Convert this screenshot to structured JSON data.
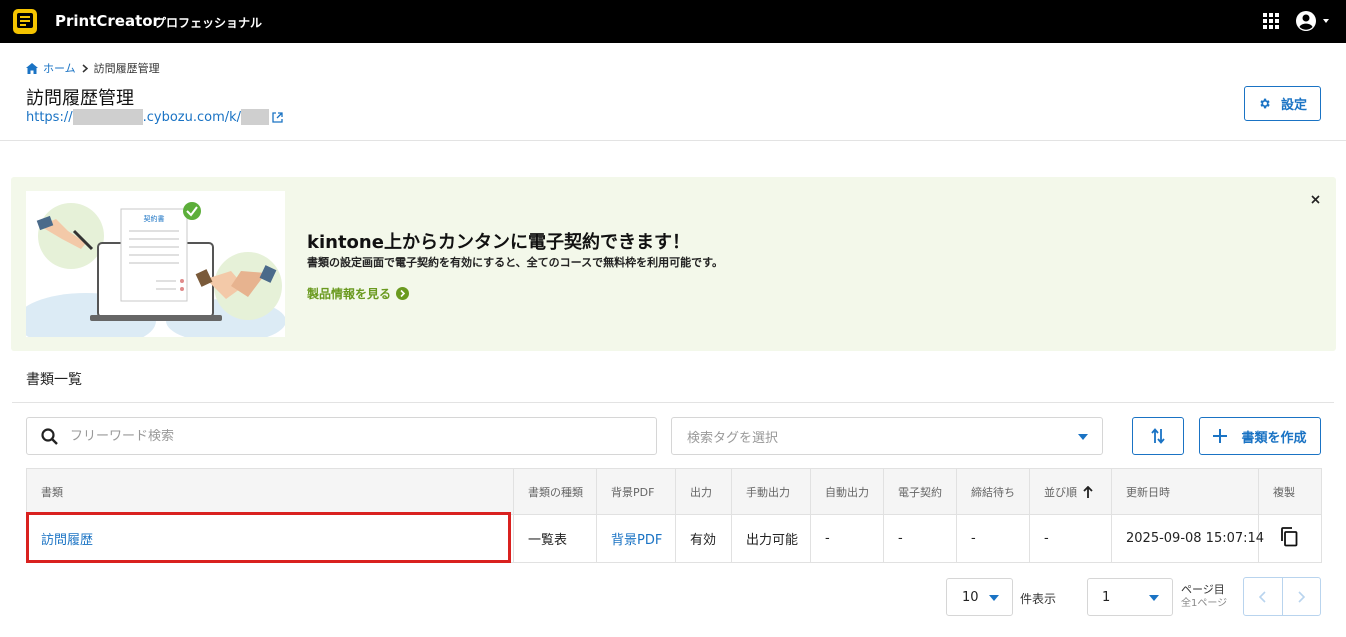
{
  "topbar": {
    "brand": "PrintCreator",
    "edition": "プロフェッショナル",
    "icons": {
      "logo": "printcreator-logo",
      "apps": "grid-apps-icon",
      "user": "account-circle-icon"
    }
  },
  "breadcrumb": {
    "home": "ホーム",
    "current": "訪問履歴管理"
  },
  "page": {
    "title": "訪問履歴管理",
    "url_prefix": "https://",
    "url_domain": ".cybozu.com/k/",
    "settings_label": "設定"
  },
  "banner": {
    "doc_label": "契約書",
    "title": "kintone上からカンタンに電子契約できます！",
    "subtitle": "書類の設定画面で電子契約を有効にすると、全てのコースで無料枠を利用可能です。",
    "link": "製品情報を見る",
    "accent_color": "#6a9a1f"
  },
  "section": {
    "title": "書類一覧"
  },
  "toolbar": {
    "search_placeholder": "フリーワード検索",
    "tag_placeholder": "検索タグを選択",
    "create_label": "書類を作成"
  },
  "table": {
    "headers": [
      "書類",
      "書類の種類",
      "背景PDF",
      "出力",
      "手動出力",
      "自動出力",
      "電子契約",
      "締結待ち",
      "並び順",
      "更新日時",
      "複製"
    ],
    "rows": [
      [
        "訪問履歴",
        "一覧表",
        "背景PDF",
        "有効",
        "出力可能",
        "-",
        "-",
        "-",
        "-",
        "2025-09-08 15:07:14"
      ]
    ]
  },
  "pagination": {
    "per_page": "10",
    "per_page_label": "件表示",
    "page": "1",
    "page_label": "ページ目",
    "page_total": "全1ページ"
  },
  "colors": {
    "primary": "#1a73c4",
    "highlight": "#d9211f",
    "topbar": "#000000"
  }
}
